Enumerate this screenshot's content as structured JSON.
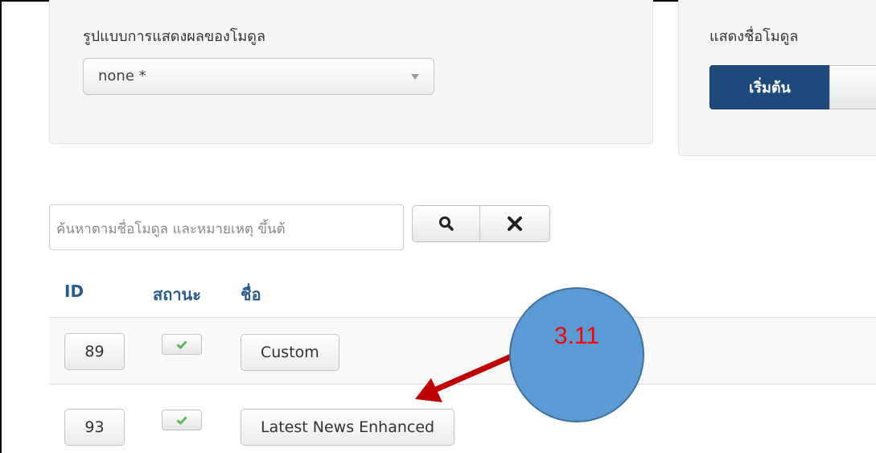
{
  "module_style": {
    "label": "รูปแบบการแสดงผลของโมดูล",
    "selected": "none *"
  },
  "show_title": {
    "label": "แสดงชื่อโมดูล",
    "active_option": "เริ่มต้น"
  },
  "search": {
    "placeholder": "ค้นหาตามชื่อโมดูล และหมายเหตุ ขึ้นต้",
    "search_icon": "search-icon",
    "clear_icon": "close-icon"
  },
  "table": {
    "headers": {
      "id": "ID",
      "status": "สถานะ",
      "name": "ชื่อ"
    },
    "rows": [
      {
        "id": "89",
        "published": true,
        "name": "Custom"
      },
      {
        "id": "93",
        "published": true,
        "name": "Latest News Enhanced"
      }
    ]
  },
  "annotation": {
    "label": "3.11",
    "circle_color": "#5b9bd5",
    "arrow_color": "#c00000",
    "text_color": "#ff0000"
  },
  "colors": {
    "primary": "#1e4a7b",
    "header_text": "#2a5d8f",
    "check": "#5cb85c"
  }
}
